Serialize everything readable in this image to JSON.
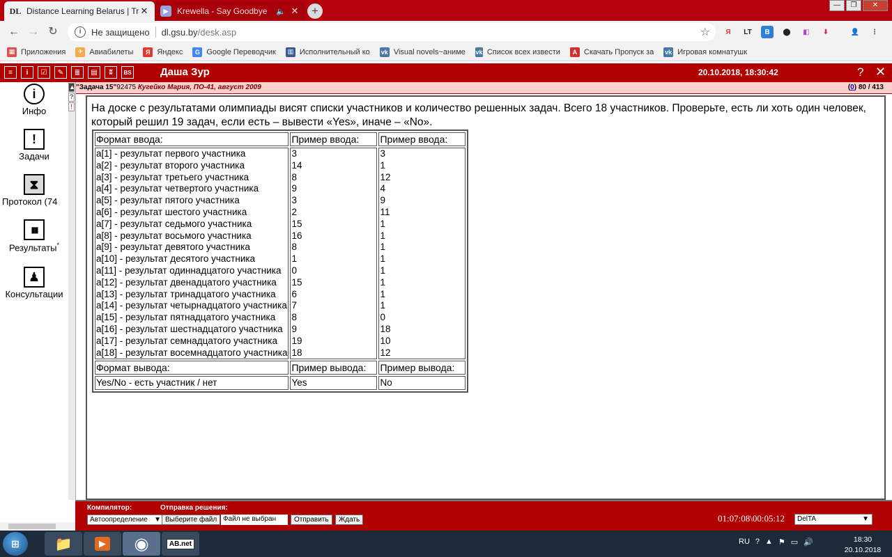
{
  "browser": {
    "tabs": [
      {
        "favicon": "DL",
        "title": "Distance Learning Belarus | Traini",
        "active": true
      },
      {
        "favicon": "▶",
        "title": "Krewella - Say Goodbye",
        "active": false
      }
    ],
    "new_tab": "+",
    "window_controls": {
      "minimize": "—",
      "maximize": "❐",
      "close": "✕"
    },
    "nav": {
      "back": "←",
      "forward": "→",
      "reload": "↻"
    },
    "omnibox": {
      "security": "Не защищено",
      "host": "dl.gsu.by",
      "path": "/desk.asp"
    },
    "star": "☆",
    "extensions": [
      "Я",
      "LT",
      "B",
      "⬤",
      "◧",
      "⬇",
      "👤",
      "⋮"
    ],
    "bookmarks": [
      {
        "icon": "apps-icon",
        "label": "Приложения",
        "color": "#d9534f"
      },
      {
        "icon": "plane-icon",
        "label": "Авиабилеты",
        "color": "#f0ad4e"
      },
      {
        "icon": "yandex-icon",
        "label": "Яндекс",
        "color": "#e03a2f"
      },
      {
        "icon": "translate-icon",
        "label": "Google Переводчик",
        "color": "#4285f4"
      },
      {
        "icon": "doc-icon",
        "label": "Исполнительный ко",
        "color": "#3b5b91"
      },
      {
        "icon": "vk-icon",
        "label": "Visual novels~аниме",
        "color": "#4a76a8"
      },
      {
        "icon": "vk-icon",
        "label": "Список всех извести",
        "color": "#4a76a8"
      },
      {
        "icon": "a-icon",
        "label": "Скачать Пропуск за",
        "color": "#d32f2f"
      },
      {
        "icon": "vk-icon",
        "label": "Игровая комнатушк",
        "color": "#4a76a8"
      }
    ]
  },
  "app": {
    "toolbar_icons": [
      "≡",
      "i",
      "☑",
      "✎",
      "≣",
      "▤",
      "ʬ",
      "BS"
    ],
    "user": "Даша Зур",
    "datetime": "20.10.2018, 18:30:42",
    "help": "?",
    "close": "✕"
  },
  "leftnav": [
    {
      "icon": "i",
      "label": "Инфо"
    },
    {
      "icon": "!",
      "label": "Задачи"
    },
    {
      "icon": "⧗",
      "label": "Протокол (74"
    },
    {
      "icon": "▮▮",
      "label": "Результаты",
      "mark": "*"
    },
    {
      "icon": "♟",
      "label": "Консультации"
    }
  ],
  "framebar": [
    "▲",
    "?",
    "!"
  ],
  "task": {
    "name": "\"Задача 15\"",
    "id": "92475",
    "author": "Кугейко Мария, ПО-41, август 2009",
    "count_open": "(",
    "count_link": "0",
    "count_close": ")",
    "count_total": "80 / 413",
    "statement": "На доске с результатами олимпиады висят списки участников и количество решенных задач. Всего 18 участников. Проверьте, есть ли хоть один человек, который решил 19 задач, если есть – вывести «Yes», иначе – «No».",
    "input_header": [
      "Формат ввода:",
      "Пример ввода:",
      "Пример ввода:"
    ],
    "input_format": [
      "a[1] - результат первого участника",
      "a[2] - результат второго участника",
      "a[3] - результат третьего участника",
      "a[4] - результат четвертого участника",
      "a[5] - результат пятого участника",
      "a[6] - результат шестого участника",
      "a[7] - результат седьмого участника",
      "a[8] - результат восьмого участника",
      "a[9] - результат девятого участника",
      "a[10] - результат десятого участника",
      "a[11] - результат одиннадцатого участника",
      "a[12] - результат двенадцатого участника",
      "a[13] - результат тринадцатого участника",
      "a[14] - результат четырнадцатого участника",
      "a[15] - результат пятнадцатого участника",
      "a[16] - результат шестнадцатого участника",
      "a[17] - результат семнадцатого участника",
      "a[18] - результат восемнадцатого участника"
    ],
    "example1_input": [
      "3",
      "14",
      "8",
      "9",
      "3",
      "2",
      "15",
      "16",
      "8",
      "1",
      "0",
      "15",
      "6",
      "7",
      "8",
      "9",
      "19",
      "18"
    ],
    "example2_input": [
      "3",
      "1",
      "12",
      "4",
      "9",
      "11",
      "1",
      "1",
      "1",
      "1",
      "1",
      "1",
      "1",
      "1",
      "0",
      "18",
      "10",
      "12"
    ],
    "output_header": [
      "Формат вывода:",
      "Пример вывода:",
      "Пример вывода:"
    ],
    "output_format": "Yes/No - есть участник / нет",
    "example1_output": "Yes",
    "example2_output": "No"
  },
  "bottom": {
    "compiler_label": "Компилятор:",
    "compiler_value": "Автоопределение",
    "submit_label": "Отправка решения:",
    "choose_file": "Выберите файл",
    "no_file": "Файл не выбран",
    "send": "Отправить",
    "wait": "Ждать",
    "timer": "01:07:08\\00:05:12",
    "language": "DelTA"
  },
  "taskbar": {
    "apps": [
      "📁",
      "▶",
      "◉",
      "AB.net"
    ],
    "lang": "RU",
    "time": "18:30",
    "date": "20.10.2018"
  }
}
